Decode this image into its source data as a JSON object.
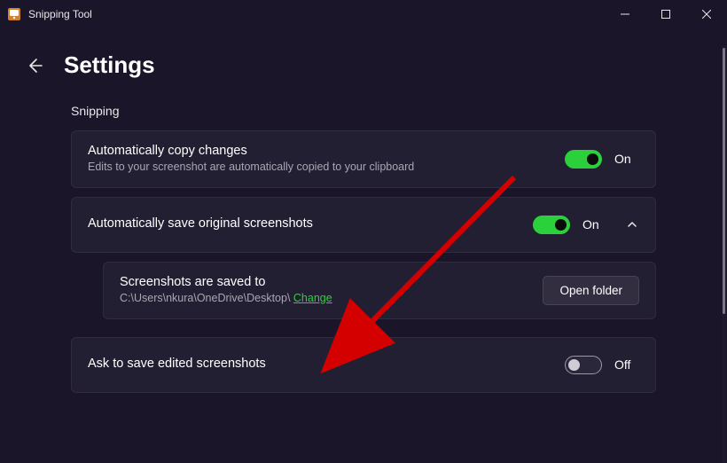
{
  "titlebar": {
    "app_name": "Snipping Tool"
  },
  "header": {
    "page_title": "Settings"
  },
  "section": {
    "label": "Snipping"
  },
  "settings": {
    "auto_copy": {
      "title": "Automatically copy changes",
      "subtitle": "Edits to your screenshot are automatically copied to your clipboard",
      "state_label": "On"
    },
    "auto_save": {
      "title": "Automatically save original screenshots",
      "state_label": "On"
    },
    "save_location": {
      "title": "Screenshots are saved to",
      "path": "C:\\Users\\nkura\\OneDrive\\Desktop\\ ",
      "change_label": "Change",
      "open_folder_label": "Open folder"
    },
    "ask_save": {
      "title": "Ask to save edited screenshots",
      "state_label": "Off"
    }
  }
}
